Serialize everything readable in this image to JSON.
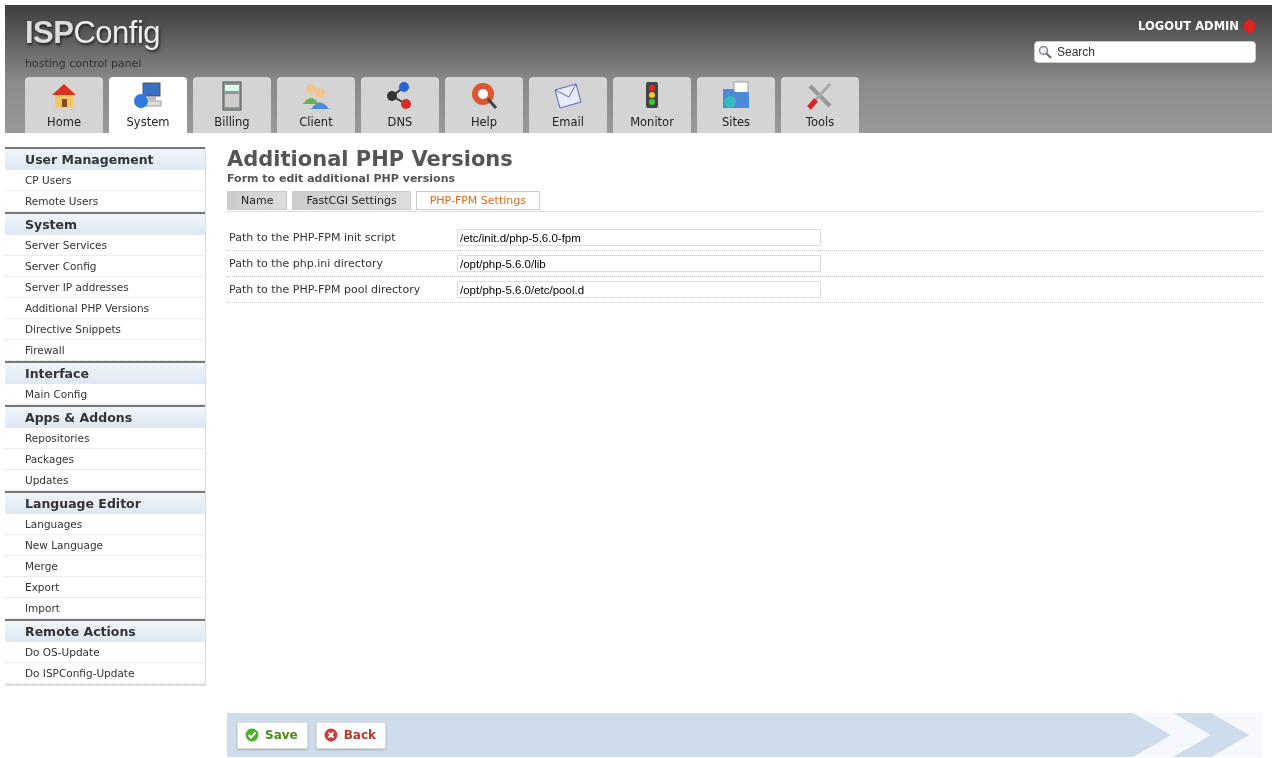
{
  "header": {
    "logo_bold": "ISP",
    "logo_rest": "Config",
    "tagline": "hosting control panel",
    "logout": "LOGOUT ADMIN",
    "search": {
      "placeholder": "Search"
    }
  },
  "tabs": [
    {
      "label": "Home",
      "selected": false
    },
    {
      "label": "System",
      "selected": true
    },
    {
      "label": "Billing",
      "selected": false
    },
    {
      "label": "Client",
      "selected": false
    },
    {
      "label": "DNS",
      "selected": false
    },
    {
      "label": "Help",
      "selected": false
    },
    {
      "label": "Email",
      "selected": false
    },
    {
      "label": "Monitor",
      "selected": false
    },
    {
      "label": "Sites",
      "selected": false
    },
    {
      "label": "Tools",
      "selected": false
    }
  ],
  "sidebar": [
    {
      "title": "User Management",
      "items": [
        "CP Users",
        "Remote Users"
      ]
    },
    {
      "title": "System",
      "items": [
        "Server Services",
        "Server Config",
        "Server IP addresses",
        "Additional PHP Versions",
        "Directive Snippets",
        "Firewall"
      ]
    },
    {
      "title": "Interface",
      "items": [
        "Main Config"
      ]
    },
    {
      "title": "Apps & Addons",
      "items": [
        "Repositories",
        "Packages",
        "Updates"
      ]
    },
    {
      "title": "Language Editor",
      "items": [
        "Languages",
        "New Language",
        "Merge",
        "Export",
        "Import"
      ]
    },
    {
      "title": "Remote Actions",
      "items": [
        "Do OS-Update",
        "Do ISPConfig-Update"
      ]
    }
  ],
  "page": {
    "title": "Additional PHP Versions",
    "subtitle": "Form to edit additional PHP versions"
  },
  "form_tabs": [
    {
      "label": "Name",
      "selected": false
    },
    {
      "label": "FastCGI Settings",
      "selected": false
    },
    {
      "label": "PHP-FPM Settings",
      "selected": true
    }
  ],
  "fields": [
    {
      "label": "Path to the PHP-FPM init script",
      "value": "/etc/init.d/php-5.6.0-fpm"
    },
    {
      "label": "Path to the php.ini directory",
      "value": "/opt/php-5.6.0/lib"
    },
    {
      "label": "Path to the PHP-FPM pool directory",
      "value": "/opt/php-5.6.0/etc/pool.d"
    }
  ],
  "buttons": [
    {
      "label": "Save",
      "kind": "save"
    },
    {
      "label": "Back",
      "kind": "back"
    }
  ]
}
